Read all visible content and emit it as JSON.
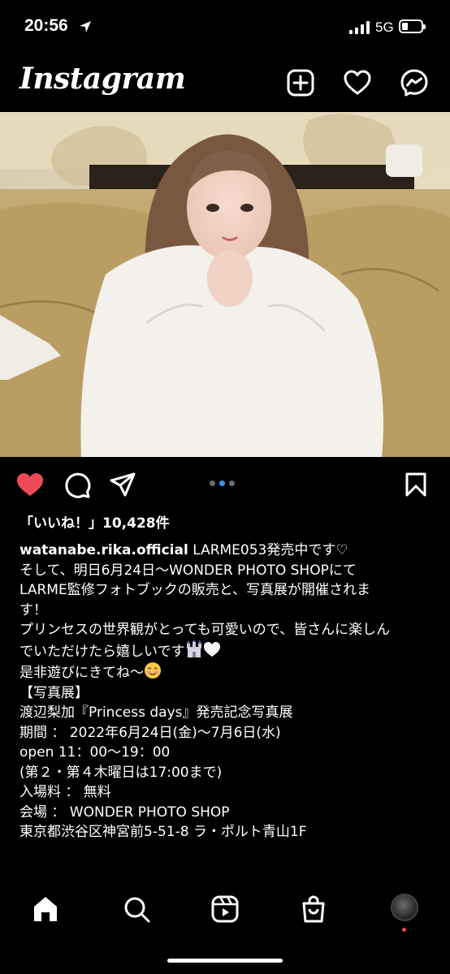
{
  "status": {
    "time": "20:56",
    "network": "5G"
  },
  "header": {
    "logo": "Instagram",
    "icons": [
      "new-post-icon",
      "heart-icon",
      "messenger-icon"
    ]
  },
  "post": {
    "carousel": {
      "count": 3,
      "active": 2
    },
    "likes": "「いいね！」10,428件",
    "username": "watanabe.rika.official",
    "caption_first": "LARME053発売中です♡",
    "lines": [
      "そして、明日6月24日〜WONDER PHOTO SHOPにて",
      "LARME監修フォトブックの販売と、写真展が開催されま",
      "す！",
      "プリンセスの世界観がとっても可愛いので、皆さんに楽しん",
      "でいただけたら嬉しいです",
      "是非遊びにきてね〜",
      "",
      "【写真展】",
      "渡辺梨加『Princess days』発売記念写真展",
      "期間 ： 2022年6月24日(金)〜7月6日(水)",
      "open 11：00〜19：00",
      "(第２・第４木曜日は17:00まで)",
      "入場料 ： 無料",
      "会場 ： WONDER PHOTO SHOP",
      "東京都渋谷区神宮前5-51-8 ラ・ポルト青山1F"
    ]
  },
  "nav": [
    "home-icon",
    "search-icon",
    "reels-icon",
    "shop-icon",
    "profile-avatar"
  ],
  "colors": {
    "like": "#ed4956",
    "carousel_active": "#3897f0"
  }
}
